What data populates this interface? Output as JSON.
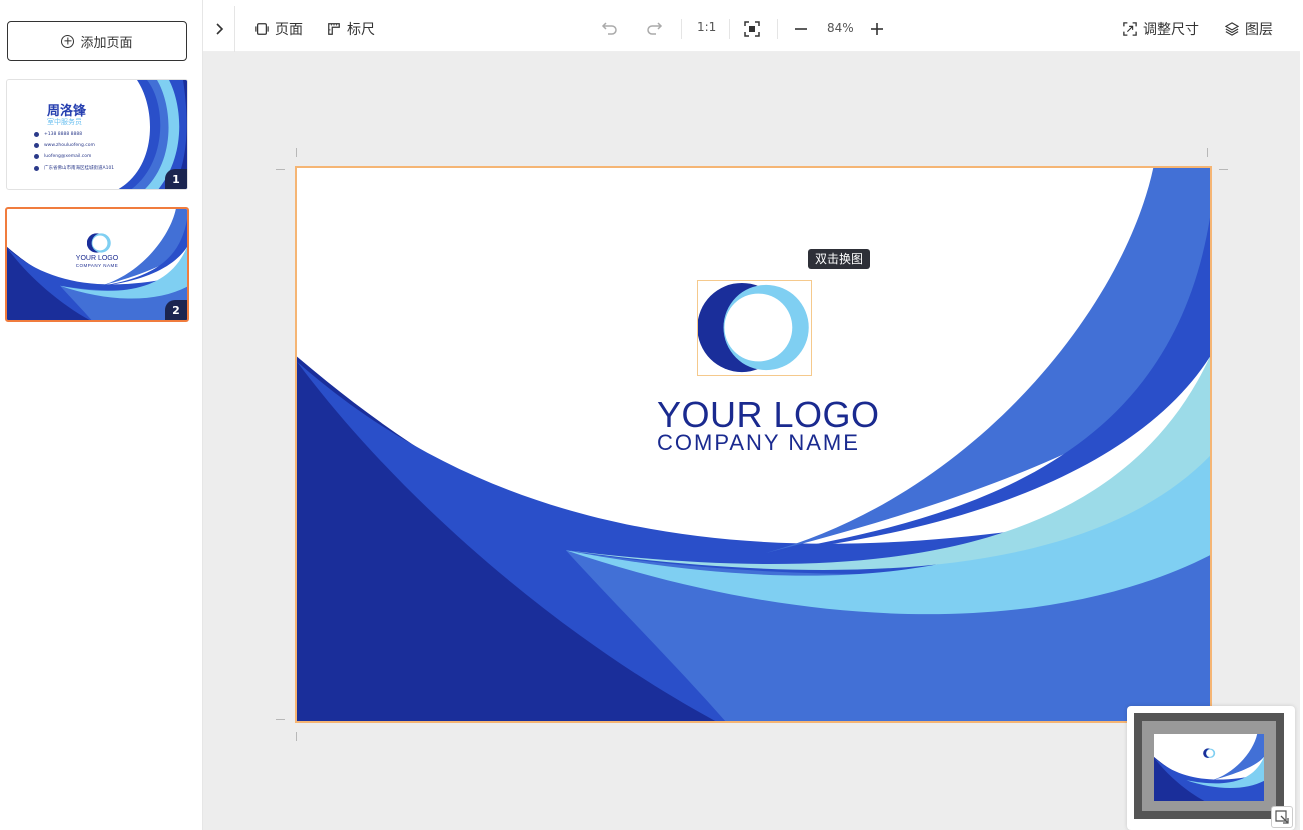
{
  "sidebar": {
    "add_page_label": "添加页面",
    "pages": [
      {
        "number": "1",
        "name": "周洛锋",
        "title": "室中服务员",
        "phone": "+138 8888 8888",
        "website": "www.zhouluofeng.com",
        "email": "luofeng@xemail.com",
        "address": "广东省佛山市南海区桂城街道A101"
      },
      {
        "number": "2",
        "logo": "YOUR LOGO",
        "company": "COMPANY NAME"
      }
    ]
  },
  "toolbar": {
    "page_label": "页面",
    "ruler_label": "标尺",
    "ratio_label": "1:1",
    "zoom": "84%",
    "resize_label": "调整尺寸",
    "layers_label": "图层"
  },
  "canvas": {
    "tooltip": "双击换图",
    "logo_text": "YOUR LOGO",
    "company_name": "COMPANY NAME"
  },
  "colors": {
    "dark_blue": "#1a2e9a",
    "royal_blue": "#2a4fc9",
    "mid_blue": "#4270d6",
    "light_blue": "#7fcff2",
    "pale_blue": "#9cdbe8",
    "selected_border": "#f07c3d"
  }
}
